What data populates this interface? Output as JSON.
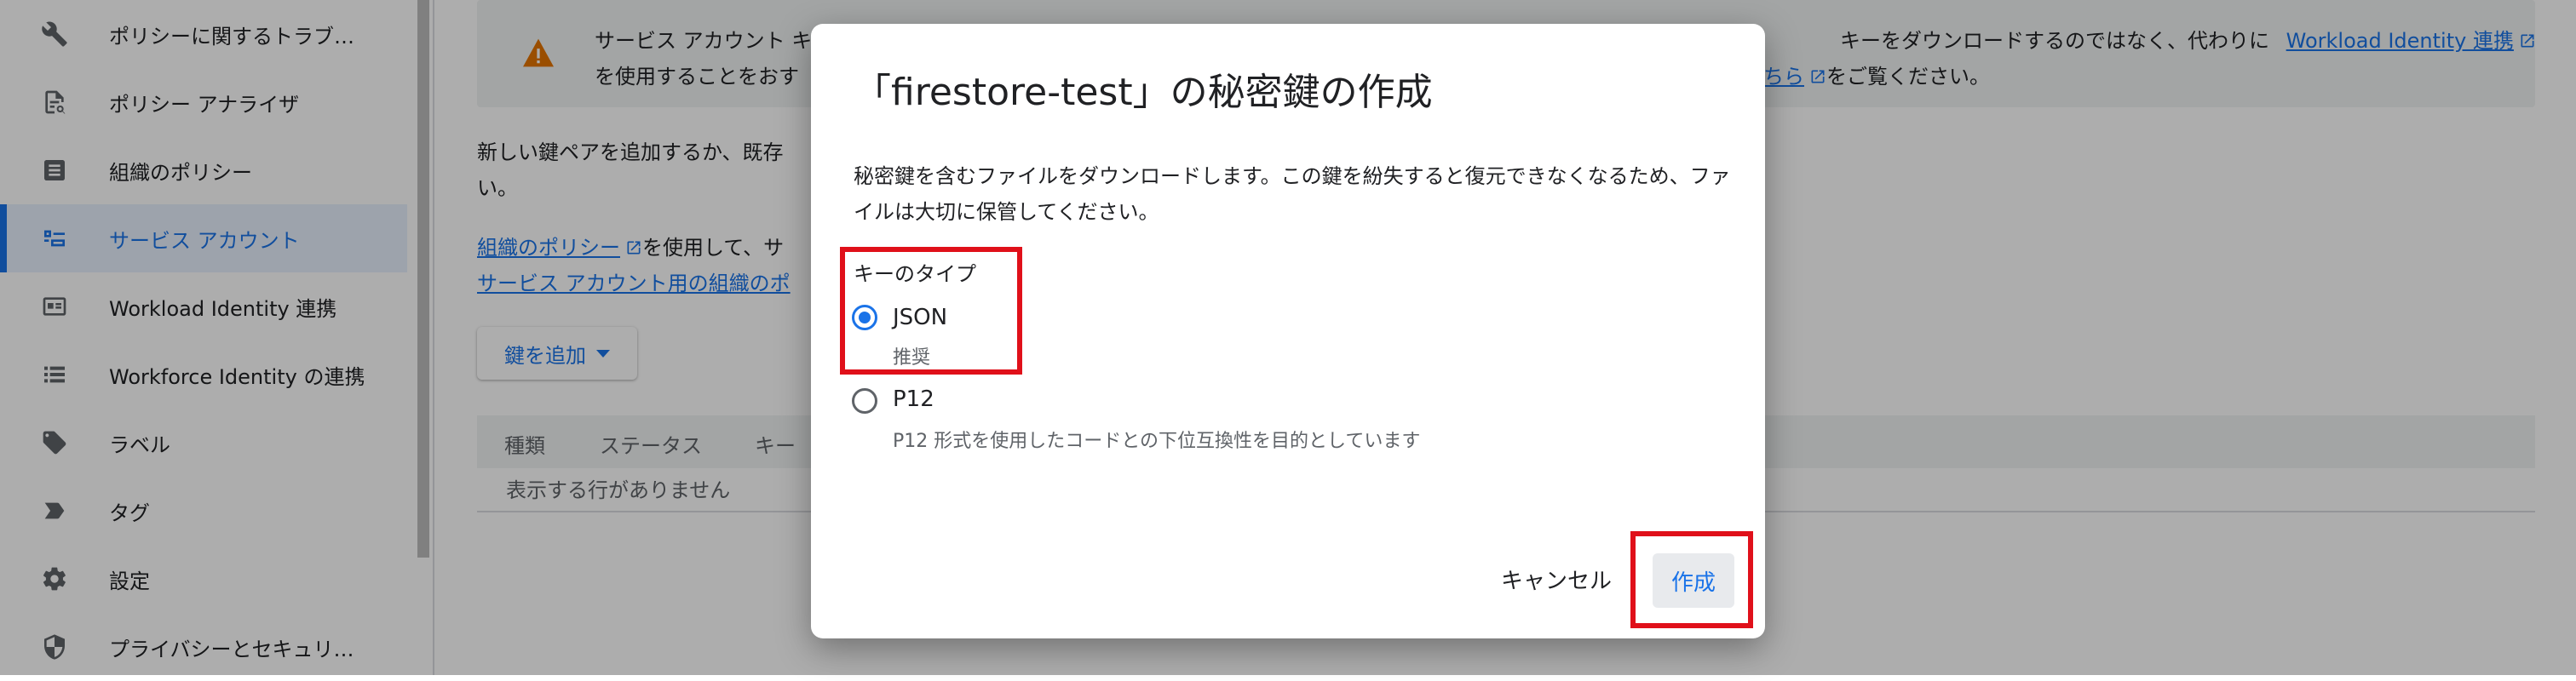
{
  "sidebar": {
    "items": [
      {
        "label": "ポリシーに関するトラブ…",
        "icon": "wrench-icon"
      },
      {
        "label": "ポリシー アナライザ",
        "icon": "policy-analyzer-icon"
      },
      {
        "label": "組織のポリシー",
        "icon": "document-icon"
      },
      {
        "label": "サービス アカウント",
        "icon": "service-account-icon"
      },
      {
        "label": "Workload Identity 連携",
        "icon": "id-card-icon"
      },
      {
        "label": "Workforce Identity の連携",
        "icon": "list-icon"
      },
      {
        "label": "ラベル",
        "icon": "label-icon"
      },
      {
        "label": "タグ",
        "icon": "tag-icon"
      },
      {
        "label": "設定",
        "icon": "gear-icon"
      },
      {
        "label": "プライバシーとセキュリ…",
        "icon": "shield-icon"
      }
    ]
  },
  "banner": {
    "line1_left": "サービス アカウント キ",
    "line1_right": "キーをダウンロードするのではなく、代わりに",
    "line1_link": "Workload Identity 連携",
    "line2_left": "を使用することをおす",
    "line2_link": "ちら",
    "line2_right": "をご覧ください。"
  },
  "main": {
    "intro_line1": "新しい鍵ペアを追加するか、既存",
    "intro_line2": "い。",
    "org_policy_link": "組織のポリシー",
    "org_policy_text": "を使用して、サ",
    "sa_org_link": "サービス アカウント用の組織のポ",
    "add_key_label": "鍵を追加",
    "table_headers": [
      "種類",
      "ステータス",
      "キー"
    ],
    "empty_message": "表示する行がありません"
  },
  "dialog": {
    "title": "「firestore-test」の秘密鍵の作成",
    "description": "秘密鍵を含むファイルをダウンロードします。この鍵を紛失すると復元できなくなるため、ファイルは大切に保管してください。",
    "key_type_label": "キーのタイプ",
    "options": [
      {
        "label": "JSON",
        "sublabel": "推奨",
        "selected": true
      },
      {
        "label": "P12",
        "sublabel": "P12 形式を使用したコードとの下位互換性を目的としています",
        "selected": false
      }
    ],
    "cancel_label": "キャンセル",
    "create_label": "作成"
  },
  "colors": {
    "accent": "#1a73e8",
    "highlight": "#e0101a",
    "warning": "#e37400"
  }
}
